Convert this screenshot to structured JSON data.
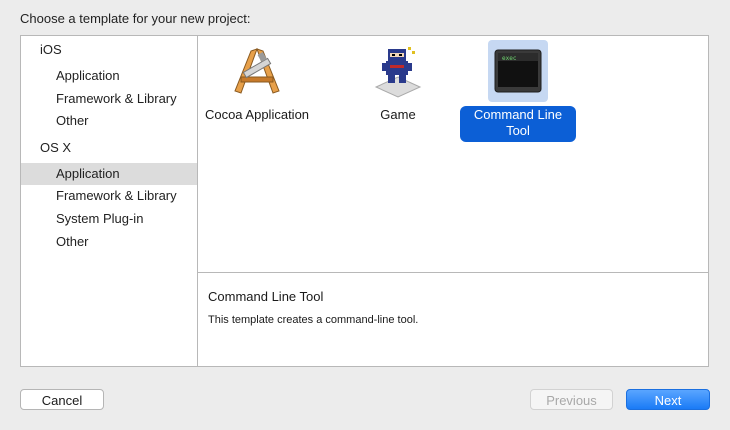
{
  "header": {
    "title": "Choose a template for your new project:"
  },
  "sidebar": {
    "sections": [
      {
        "label": "iOS",
        "items": [
          "Application",
          "Framework & Library",
          "Other"
        ]
      },
      {
        "label": "OS X",
        "items": [
          "Application",
          "Framework & Library",
          "System Plug-in",
          "Other"
        ]
      }
    ],
    "selected": "OS X / Application"
  },
  "templates": [
    {
      "label": "Cocoa Application",
      "icon": "cocoa-app-icon"
    },
    {
      "label": "Game",
      "icon": "game-ninja-icon"
    },
    {
      "label": "Command Line Tool",
      "icon": "terminal-exec-icon",
      "icon_text": "exec"
    }
  ],
  "selected_template": "Command Line Tool",
  "description": {
    "title": "Command Line Tool",
    "text": "This template creates a command-line tool."
  },
  "buttons": {
    "cancel": "Cancel",
    "previous": "Previous",
    "next": "Next"
  },
  "colors": {
    "selection_blue": "#0c5fd6",
    "next_button_blue": "#1a7bf6",
    "sidebar_selected": "#dcdcdc"
  }
}
